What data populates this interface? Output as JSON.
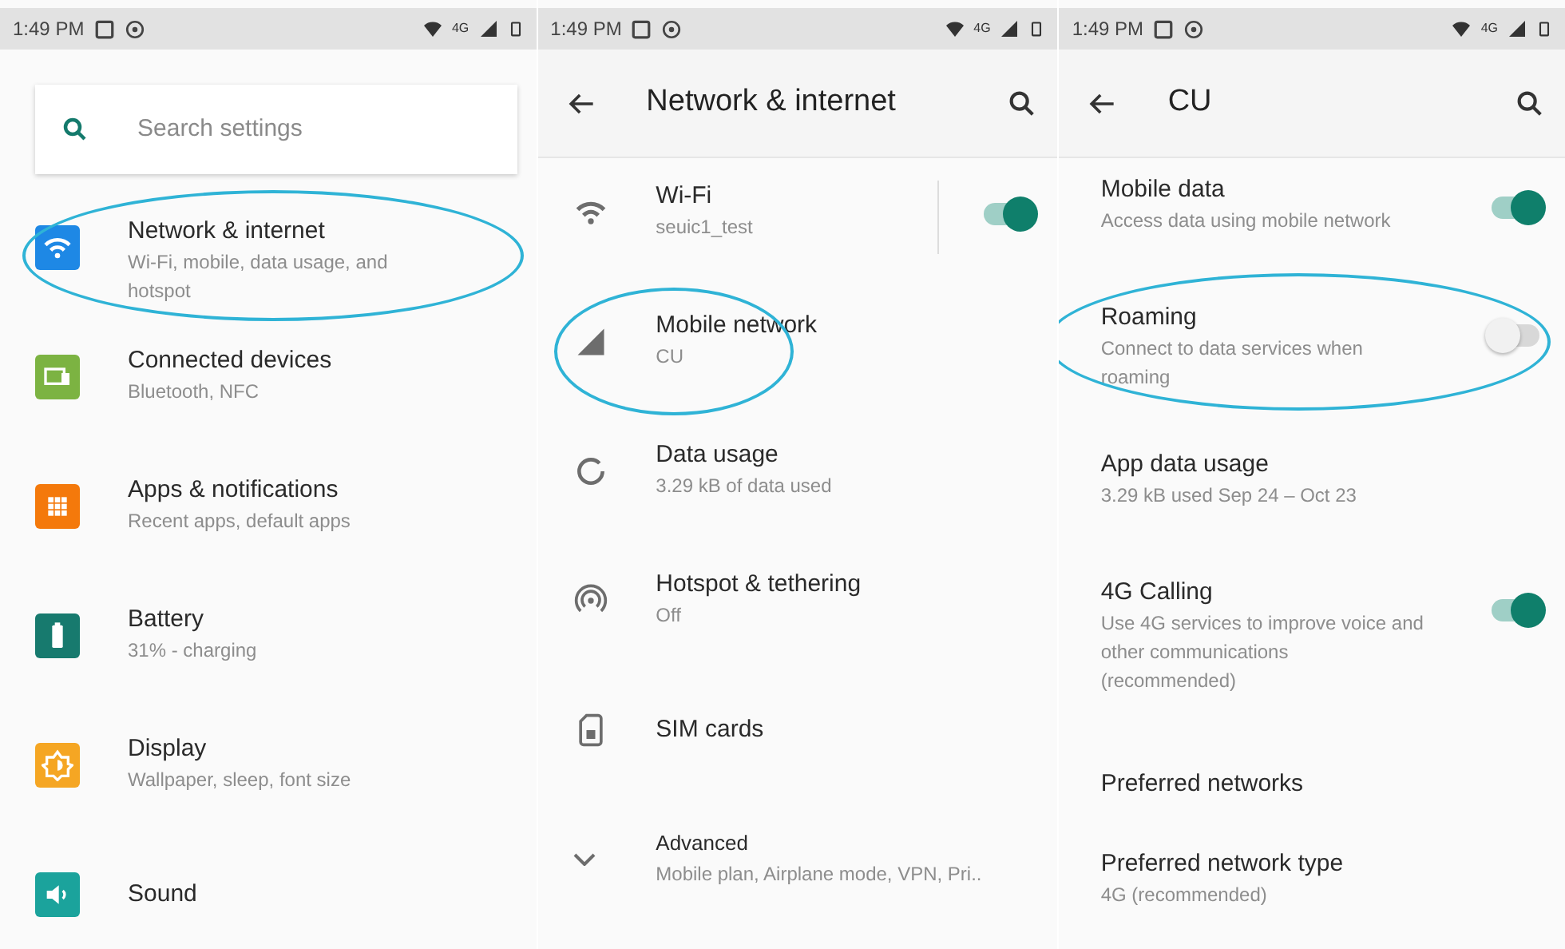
{
  "panels": [
    {
      "kind": "home",
      "status_bar": {
        "time": "1:49 PM",
        "network": "4G"
      },
      "search": {
        "placeholder": "Search settings"
      },
      "items": [
        {
          "title": "Network & internet",
          "subtitle": "Wi-Fi, mobile, data usage, and hotspot",
          "color": "#1e88e5",
          "highlighted": true
        },
        {
          "title": "Connected devices",
          "subtitle": "Bluetooth, NFC",
          "color": "#7cb342",
          "highlighted": false
        },
        {
          "title": "Apps & notifications",
          "subtitle": "Recent apps, default apps",
          "color": "#f4790b",
          "highlighted": false
        },
        {
          "title": "Battery",
          "subtitle": "31% - charging",
          "color": "#177a6e",
          "highlighted": false
        },
        {
          "title": "Display",
          "subtitle": "Wallpaper, sleep, font size",
          "color": "#f5a623",
          "highlighted": false
        },
        {
          "title": "Sound",
          "color": "#1ba39c",
          "highlighted": false
        }
      ]
    },
    {
      "kind": "list",
      "status_bar": {
        "time": "1:49 PM",
        "network": "4G"
      },
      "header": {
        "title": "Network & internet"
      },
      "items": [
        {
          "title": "Wi-Fi",
          "subtitle": "seuic1_test",
          "on": true,
          "highlighted": false
        },
        {
          "title": "Mobile network",
          "subtitle": "CU",
          "highlighted": true
        },
        {
          "title": "Data usage",
          "subtitle": "3.29 kB of data used",
          "highlighted": false
        },
        {
          "title": "Hotspot & tethering",
          "subtitle": "Off",
          "highlighted": false
        },
        {
          "title": "SIM cards",
          "highlighted": false
        },
        {
          "title": "Advanced",
          "subtitle": "Mobile plan, Airplane mode, VPN, Pri..",
          "highlighted": false
        }
      ]
    },
    {
      "kind": "detail",
      "status_bar": {
        "time": "1:49 PM",
        "network": "4G"
      },
      "header": {
        "title": "CU"
      },
      "items": [
        {
          "title": "Mobile data",
          "subtitle": "Access data using mobile network",
          "on": true,
          "highlighted": false
        },
        {
          "title": "Roaming",
          "subtitle": "Connect to data services when roaming",
          "on": false,
          "highlighted": true
        },
        {
          "title": "App data usage",
          "subtitle": "3.29 kB used Sep 24 – Oct 23",
          "highlighted": false
        },
        {
          "title": "4G Calling",
          "subtitle": "Use 4G services to improve voice and other communications (recommended)",
          "on": true,
          "highlighted": false
        },
        {
          "title": "Preferred networks",
          "highlighted": false
        },
        {
          "title": "Preferred network type",
          "subtitle": "4G (recommended)",
          "highlighted": false
        }
      ]
    }
  ]
}
